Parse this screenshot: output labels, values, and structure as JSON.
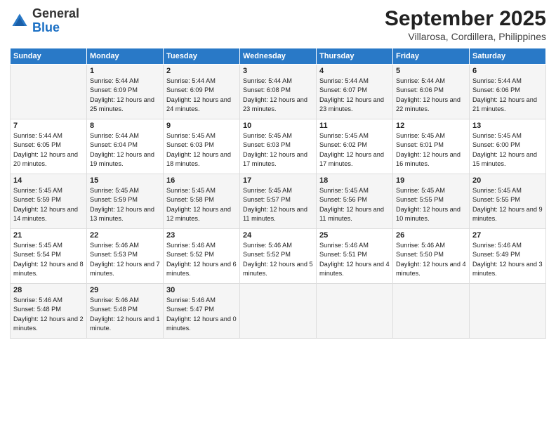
{
  "header": {
    "logo": {
      "general": "General",
      "blue": "Blue"
    },
    "title": "September 2025",
    "location": "Villarosa, Cordillera, Philippines"
  },
  "days_of_week": [
    "Sunday",
    "Monday",
    "Tuesday",
    "Wednesday",
    "Thursday",
    "Friday",
    "Saturday"
  ],
  "weeks": [
    [
      {
        "day": "",
        "sunrise": "",
        "sunset": "",
        "daylight": ""
      },
      {
        "day": "1",
        "sunrise": "Sunrise: 5:44 AM",
        "sunset": "Sunset: 6:09 PM",
        "daylight": "Daylight: 12 hours and 25 minutes."
      },
      {
        "day": "2",
        "sunrise": "Sunrise: 5:44 AM",
        "sunset": "Sunset: 6:09 PM",
        "daylight": "Daylight: 12 hours and 24 minutes."
      },
      {
        "day": "3",
        "sunrise": "Sunrise: 5:44 AM",
        "sunset": "Sunset: 6:08 PM",
        "daylight": "Daylight: 12 hours and 23 minutes."
      },
      {
        "day": "4",
        "sunrise": "Sunrise: 5:44 AM",
        "sunset": "Sunset: 6:07 PM",
        "daylight": "Daylight: 12 hours and 23 minutes."
      },
      {
        "day": "5",
        "sunrise": "Sunrise: 5:44 AM",
        "sunset": "Sunset: 6:06 PM",
        "daylight": "Daylight: 12 hours and 22 minutes."
      },
      {
        "day": "6",
        "sunrise": "Sunrise: 5:44 AM",
        "sunset": "Sunset: 6:06 PM",
        "daylight": "Daylight: 12 hours and 21 minutes."
      }
    ],
    [
      {
        "day": "7",
        "sunrise": "Sunrise: 5:44 AM",
        "sunset": "Sunset: 6:05 PM",
        "daylight": "Daylight: 12 hours and 20 minutes."
      },
      {
        "day": "8",
        "sunrise": "Sunrise: 5:44 AM",
        "sunset": "Sunset: 6:04 PM",
        "daylight": "Daylight: 12 hours and 19 minutes."
      },
      {
        "day": "9",
        "sunrise": "Sunrise: 5:45 AM",
        "sunset": "Sunset: 6:03 PM",
        "daylight": "Daylight: 12 hours and 18 minutes."
      },
      {
        "day": "10",
        "sunrise": "Sunrise: 5:45 AM",
        "sunset": "Sunset: 6:03 PM",
        "daylight": "Daylight: 12 hours and 17 minutes."
      },
      {
        "day": "11",
        "sunrise": "Sunrise: 5:45 AM",
        "sunset": "Sunset: 6:02 PM",
        "daylight": "Daylight: 12 hours and 17 minutes."
      },
      {
        "day": "12",
        "sunrise": "Sunrise: 5:45 AM",
        "sunset": "Sunset: 6:01 PM",
        "daylight": "Daylight: 12 hours and 16 minutes."
      },
      {
        "day": "13",
        "sunrise": "Sunrise: 5:45 AM",
        "sunset": "Sunset: 6:00 PM",
        "daylight": "Daylight: 12 hours and 15 minutes."
      }
    ],
    [
      {
        "day": "14",
        "sunrise": "Sunrise: 5:45 AM",
        "sunset": "Sunset: 5:59 PM",
        "daylight": "Daylight: 12 hours and 14 minutes."
      },
      {
        "day": "15",
        "sunrise": "Sunrise: 5:45 AM",
        "sunset": "Sunset: 5:59 PM",
        "daylight": "Daylight: 12 hours and 13 minutes."
      },
      {
        "day": "16",
        "sunrise": "Sunrise: 5:45 AM",
        "sunset": "Sunset: 5:58 PM",
        "daylight": "Daylight: 12 hours and 12 minutes."
      },
      {
        "day": "17",
        "sunrise": "Sunrise: 5:45 AM",
        "sunset": "Sunset: 5:57 PM",
        "daylight": "Daylight: 12 hours and 11 minutes."
      },
      {
        "day": "18",
        "sunrise": "Sunrise: 5:45 AM",
        "sunset": "Sunset: 5:56 PM",
        "daylight": "Daylight: 12 hours and 11 minutes."
      },
      {
        "day": "19",
        "sunrise": "Sunrise: 5:45 AM",
        "sunset": "Sunset: 5:55 PM",
        "daylight": "Daylight: 12 hours and 10 minutes."
      },
      {
        "day": "20",
        "sunrise": "Sunrise: 5:45 AM",
        "sunset": "Sunset: 5:55 PM",
        "daylight": "Daylight: 12 hours and 9 minutes."
      }
    ],
    [
      {
        "day": "21",
        "sunrise": "Sunrise: 5:45 AM",
        "sunset": "Sunset: 5:54 PM",
        "daylight": "Daylight: 12 hours and 8 minutes."
      },
      {
        "day": "22",
        "sunrise": "Sunrise: 5:46 AM",
        "sunset": "Sunset: 5:53 PM",
        "daylight": "Daylight: 12 hours and 7 minutes."
      },
      {
        "day": "23",
        "sunrise": "Sunrise: 5:46 AM",
        "sunset": "Sunset: 5:52 PM",
        "daylight": "Daylight: 12 hours and 6 minutes."
      },
      {
        "day": "24",
        "sunrise": "Sunrise: 5:46 AM",
        "sunset": "Sunset: 5:52 PM",
        "daylight": "Daylight: 12 hours and 5 minutes."
      },
      {
        "day": "25",
        "sunrise": "Sunrise: 5:46 AM",
        "sunset": "Sunset: 5:51 PM",
        "daylight": "Daylight: 12 hours and 4 minutes."
      },
      {
        "day": "26",
        "sunrise": "Sunrise: 5:46 AM",
        "sunset": "Sunset: 5:50 PM",
        "daylight": "Daylight: 12 hours and 4 minutes."
      },
      {
        "day": "27",
        "sunrise": "Sunrise: 5:46 AM",
        "sunset": "Sunset: 5:49 PM",
        "daylight": "Daylight: 12 hours and 3 minutes."
      }
    ],
    [
      {
        "day": "28",
        "sunrise": "Sunrise: 5:46 AM",
        "sunset": "Sunset: 5:48 PM",
        "daylight": "Daylight: 12 hours and 2 minutes."
      },
      {
        "day": "29",
        "sunrise": "Sunrise: 5:46 AM",
        "sunset": "Sunset: 5:48 PM",
        "daylight": "Daylight: 12 hours and 1 minute."
      },
      {
        "day": "30",
        "sunrise": "Sunrise: 5:46 AM",
        "sunset": "Sunset: 5:47 PM",
        "daylight": "Daylight: 12 hours and 0 minutes."
      },
      {
        "day": "",
        "sunrise": "",
        "sunset": "",
        "daylight": ""
      },
      {
        "day": "",
        "sunrise": "",
        "sunset": "",
        "daylight": ""
      },
      {
        "day": "",
        "sunrise": "",
        "sunset": "",
        "daylight": ""
      },
      {
        "day": "",
        "sunrise": "",
        "sunset": "",
        "daylight": ""
      }
    ]
  ]
}
